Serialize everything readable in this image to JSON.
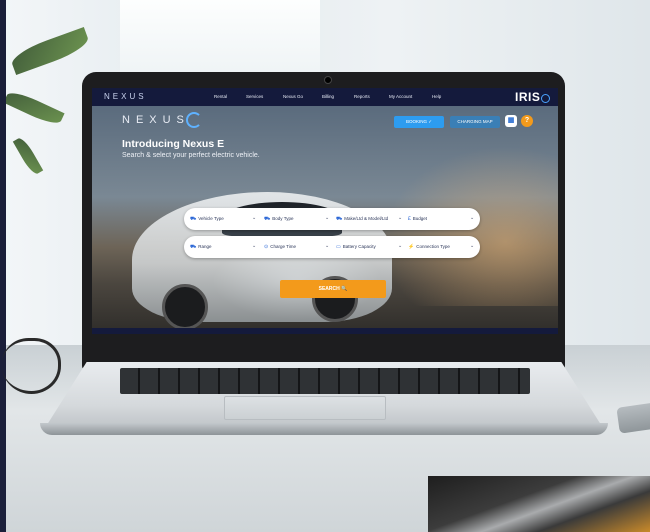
{
  "app": {
    "brand_small": "NEXUS",
    "brand_large": "NEXUS",
    "iris_logo": "IRIS"
  },
  "nav": {
    "items": [
      "Rental",
      "Services",
      "Nexus Go",
      "Billing",
      "Reports",
      "My Account",
      "Help"
    ]
  },
  "hero": {
    "title": "Introducing Nexus E",
    "subtitle": "Search & select your perfect electric vehicle."
  },
  "actions": {
    "booking_label": "BOOKING ✓",
    "charging_map_label": "CHARGING MAP",
    "help_icon": "?"
  },
  "filters_row1": [
    {
      "icon": "car-icon",
      "glyph": "⛟",
      "label": "Vehicle Type"
    },
    {
      "icon": "car-body-icon",
      "glyph": "⛟",
      "label": "Body Type"
    },
    {
      "icon": "car-make-icon",
      "glyph": "⛟",
      "label": "Make/Ltd & Model/Ltd"
    },
    {
      "icon": "pound-icon",
      "glyph": "£",
      "label": "Budget"
    }
  ],
  "filters_row2": [
    {
      "icon": "range-icon",
      "glyph": "⛟",
      "label": "Range"
    },
    {
      "icon": "charge-time-icon",
      "glyph": "⊙",
      "label": "Charge Time"
    },
    {
      "icon": "battery-icon",
      "glyph": "▭",
      "label": "Battery Capacity"
    },
    {
      "icon": "plug-icon",
      "glyph": "⚡",
      "label": "Connection Type"
    }
  ],
  "search": {
    "label": "SEARCH 🔍"
  },
  "colors": {
    "nav_bg": "#141a3c",
    "accent_blue": "#2d9cf0",
    "search_orange": "#f39a1b"
  }
}
